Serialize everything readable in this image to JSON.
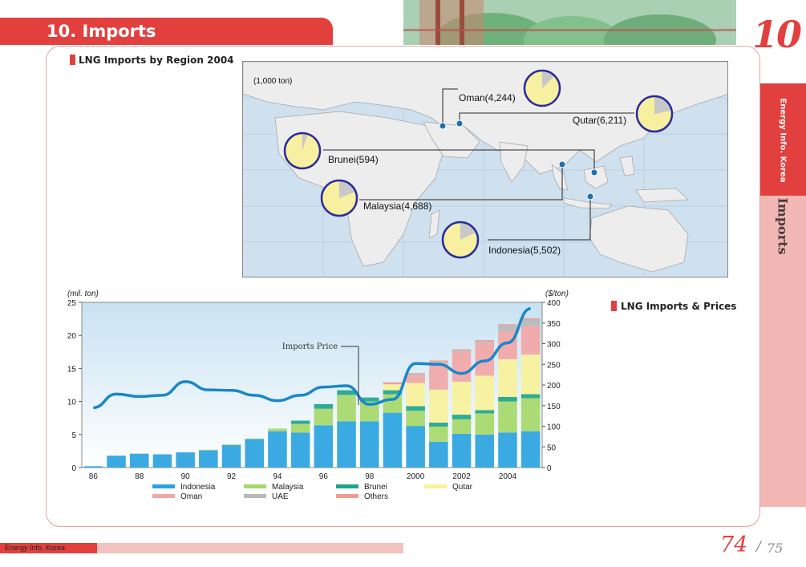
{
  "header": {
    "title": "10. Imports",
    "chapter_number": "10"
  },
  "sidebar": {
    "label_top": "Energy Info. Korea",
    "label_bottom": "Imports"
  },
  "map_section": {
    "title": "LNG Imports by Region 2004",
    "unit": "(1,000 ton)",
    "regions": [
      {
        "label": "Oman(4,244)",
        "value": 4244,
        "share": 0.125
      },
      {
        "label": "Qutar(6,211)",
        "value": 6211,
        "share": 0.22
      },
      {
        "label": "Brunei(594)",
        "value": 594,
        "share": 0.05
      },
      {
        "label": "Malaysia(4,688)",
        "value": 4688,
        "share": 0.19
      },
      {
        "label": "Indonesia(5,502)",
        "value": 5502,
        "share": 0.18
      }
    ]
  },
  "chart_section": {
    "title": "LNG Imports & Prices",
    "price_annotation": "Imports Price",
    "colors": {
      "indonesia": "#2aa3e0",
      "malaysia": "#a6d86a",
      "brunei": "#1ea58a",
      "qutar": "#f7f29a",
      "oman": "#f2a6a6",
      "uae": "#b8b8b8",
      "others": "#ef9b8e",
      "price": "#1a86c9"
    }
  },
  "chart_data": {
    "type": "bar",
    "x": [
      "86",
      "87",
      "88",
      "89",
      "90",
      "91",
      "92",
      "93",
      "94",
      "95",
      "96",
      "97",
      "98",
      "99",
      "2000",
      "2001",
      "2002",
      "2003",
      "2004",
      "2005"
    ],
    "x_tick_labels": [
      "86",
      "88",
      "90",
      "92",
      "94",
      "96",
      "98",
      "2000",
      "2002",
      "2004"
    ],
    "ylabel": "(mil. ton)",
    "ylim": [
      0,
      25
    ],
    "y_ticks": [
      0,
      5,
      10,
      15,
      20,
      25
    ],
    "y2label": "($/ton)",
    "y2lim": [
      0,
      400
    ],
    "y2_ticks": [
      0,
      50,
      100,
      150,
      200,
      250,
      300,
      350,
      400
    ],
    "legend": [
      "Indonesia",
      "Malaysia",
      "Brunei",
      "Qutar",
      "Oman",
      "UAE",
      "Others"
    ],
    "series": [
      {
        "name": "Indonesia",
        "values": [
          0.2,
          1.8,
          2.1,
          2.0,
          2.3,
          2.6,
          3.4,
          4.3,
          5.5,
          5.3,
          6.4,
          7.0,
          7.0,
          8.3,
          6.3,
          3.9,
          5.1,
          5.0,
          5.3,
          5.5
        ]
      },
      {
        "name": "Malaysia",
        "values": [
          0,
          0,
          0,
          0,
          0,
          0.1,
          0.1,
          0.1,
          0.4,
          1.3,
          2.5,
          4.0,
          3.0,
          2.8,
          2.3,
          2.3,
          2.2,
          3.2,
          4.7,
          5.0
        ]
      },
      {
        "name": "Brunei",
        "values": [
          0,
          0,
          0,
          0,
          0,
          0,
          0,
          0,
          0,
          0.5,
          0.7,
          0.7,
          0.6,
          0.6,
          0.7,
          0.6,
          0.7,
          0.5,
          0.7,
          0.6
        ]
      },
      {
        "name": "Qutar",
        "values": [
          0,
          0,
          0,
          0,
          0,
          0,
          0,
          0,
          0,
          0,
          0,
          0,
          0,
          0.9,
          3.5,
          5.0,
          5.0,
          5.2,
          5.7,
          6.0
        ]
      },
      {
        "name": "Oman",
        "values": [
          0,
          0,
          0,
          0,
          0,
          0,
          0,
          0,
          0,
          0,
          0,
          0,
          0,
          0,
          1.2,
          4.0,
          4.5,
          5.0,
          4.2,
          4.3
        ]
      },
      {
        "name": "UAE",
        "values": [
          0,
          0,
          0,
          0,
          0,
          0,
          0,
          0,
          0,
          0,
          0,
          0,
          0,
          0,
          0.2,
          0.2,
          0.2,
          0.2,
          0.9,
          1.0
        ]
      },
      {
        "name": "Others",
        "values": [
          0,
          0,
          0,
          0,
          0,
          0,
          0,
          0,
          0,
          0,
          0,
          0,
          0,
          0.3,
          0.1,
          0.2,
          0.2,
          0.2,
          0.2,
          0.2
        ]
      },
      {
        "name": "Imports Price",
        "axis": "y2",
        "type": "line",
        "values": [
          145,
          178,
          172,
          175,
          208,
          188,
          187,
          175,
          162,
          175,
          195,
          198,
          153,
          165,
          252,
          250,
          228,
          258,
          302,
          385
        ]
      }
    ]
  },
  "footer": {
    "brand": "Energy Info. Korea",
    "page_current": "74",
    "page_separator": "/",
    "page_total": "75"
  }
}
